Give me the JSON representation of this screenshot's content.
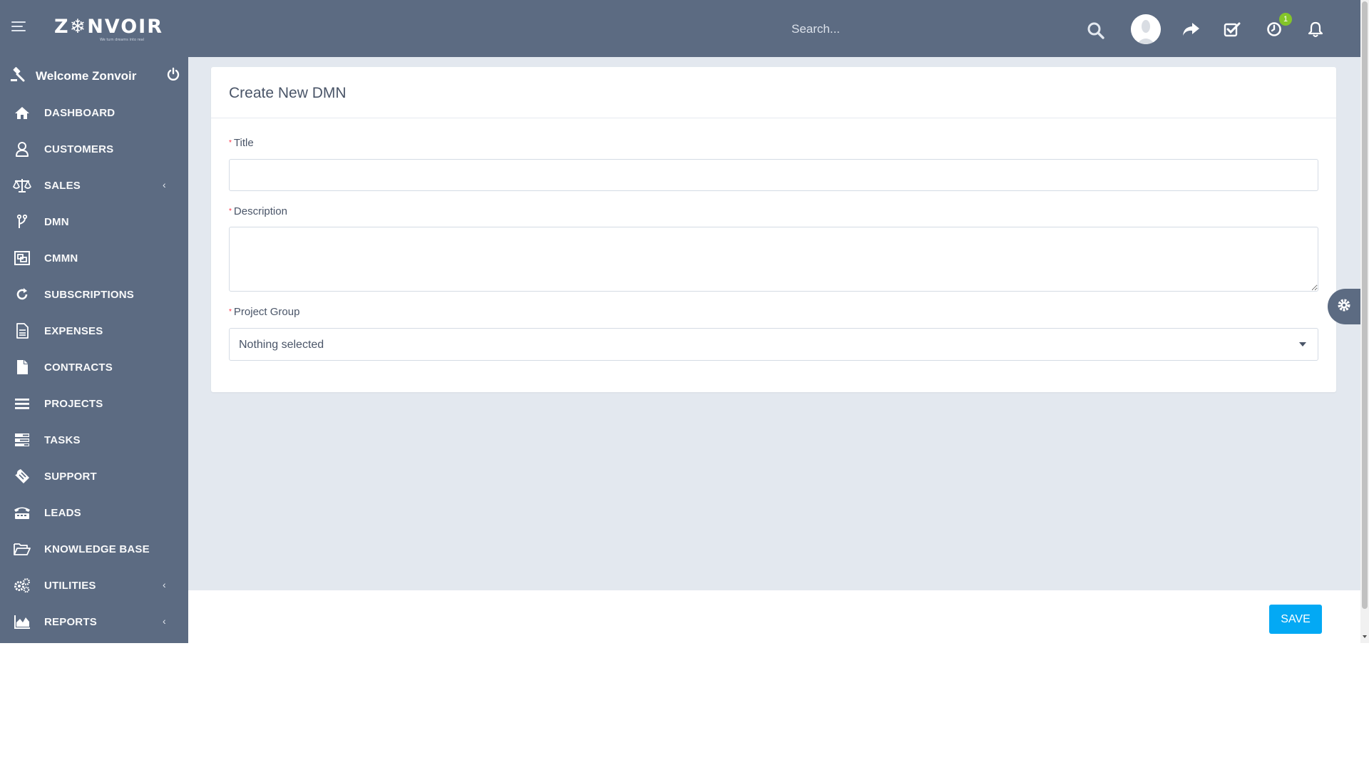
{
  "brand": {
    "logo_text": "Z❄NVOIR",
    "tagline": "We turn dreams into real"
  },
  "header": {
    "search_placeholder": "Search...",
    "notification_count": "1"
  },
  "sidebar": {
    "welcome_text": "Welcome Zonvoir",
    "items": [
      {
        "label": "DASHBOARD",
        "icon": "home-icon"
      },
      {
        "label": "CUSTOMERS",
        "icon": "user-icon"
      },
      {
        "label": "SALES",
        "icon": "balance-scale-icon",
        "has_submenu": true
      },
      {
        "label": "DMN",
        "icon": "code-fork-icon"
      },
      {
        "label": "CMMN",
        "icon": "object-group-icon"
      },
      {
        "label": "SUBSCRIPTIONS",
        "icon": "refresh-icon"
      },
      {
        "label": "EXPENSES",
        "icon": "file-text-icon"
      },
      {
        "label": "CONTRACTS",
        "icon": "file-icon"
      },
      {
        "label": "PROJECTS",
        "icon": "bars-icon"
      },
      {
        "label": "TASKS",
        "icon": "tasks-icon"
      },
      {
        "label": "SUPPORT",
        "icon": "ticket-icon"
      },
      {
        "label": "LEADS",
        "icon": "tty-icon"
      },
      {
        "label": "KNOWLEDGE BASE",
        "icon": "folder-open-icon"
      },
      {
        "label": "UTILITIES",
        "icon": "cogs-icon",
        "has_submenu": true
      },
      {
        "label": "REPORTS",
        "icon": "area-chart-icon",
        "has_submenu": true
      }
    ],
    "chevron": "‹"
  },
  "form": {
    "title": "Create New DMN",
    "required_marker": "*",
    "title_label": "Title",
    "title_value": "",
    "description_label": "Description",
    "description_value": "",
    "project_group_label": "Project Group",
    "project_group_value": "Nothing selected"
  },
  "footer": {
    "save_label": "SAVE"
  },
  "colors": {
    "header_bg": "#5c6b82",
    "sidebar_bg": "#5c6b82",
    "content_bg": "#e3e8ef",
    "save_button": "#03a9f4",
    "badge": "#84c529",
    "required": "#fc2d42"
  }
}
